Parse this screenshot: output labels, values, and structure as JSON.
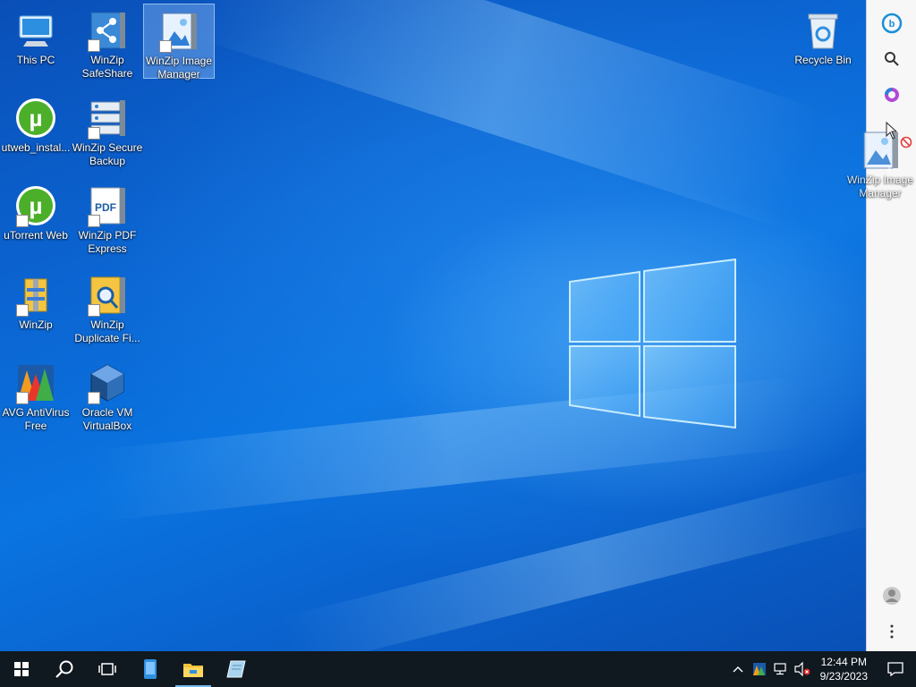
{
  "desktop": {
    "icons": [
      {
        "label": "This PC",
        "icon": "this-pc-icon"
      },
      {
        "label": "WinZip SafeShare",
        "icon": "winzip-safeshare-icon"
      },
      {
        "label": "WinZip Image Manager",
        "icon": "winzip-image-manager-icon",
        "selected": true
      },
      {
        "label": "utweb_instal...",
        "icon": "utorrent-installer-icon"
      },
      {
        "label": "WinZip Secure Backup",
        "icon": "winzip-secure-backup-icon"
      },
      {
        "label": "uTorrent Web",
        "icon": "utorrent-web-icon"
      },
      {
        "label": "WinZip PDF Express",
        "icon": "winzip-pdf-express-icon"
      },
      {
        "label": "WinZip",
        "icon": "winzip-icon"
      },
      {
        "label": "WinZip Duplicate Fi...",
        "icon": "winzip-duplicate-finder-icon"
      },
      {
        "label": "AVG AntiVirus Free",
        "icon": "avg-antivirus-icon"
      },
      {
        "label": "Oracle VM VirtualBox",
        "icon": "virtualbox-icon"
      },
      {
        "label": "Recycle Bin",
        "icon": "recycle-bin-icon"
      }
    ],
    "drag_ghost_label": "WinZip Image Manager"
  },
  "sidebar": {
    "items": [
      "bing-icon",
      "search-icon",
      "office-icon"
    ],
    "profile": "profile-icon",
    "more": "more-icon"
  },
  "taskbar": {
    "buttons": [
      "start-icon",
      "search-icon",
      "task-view-icon",
      "app-icon",
      "file-explorer-icon",
      "notepad-icon"
    ],
    "clock_time": "12:44 PM",
    "clock_date": "9/23/2023"
  },
  "colors": {
    "accent": "#76b9ed",
    "taskbar": "#101820",
    "desktop": "#0a67d4"
  }
}
